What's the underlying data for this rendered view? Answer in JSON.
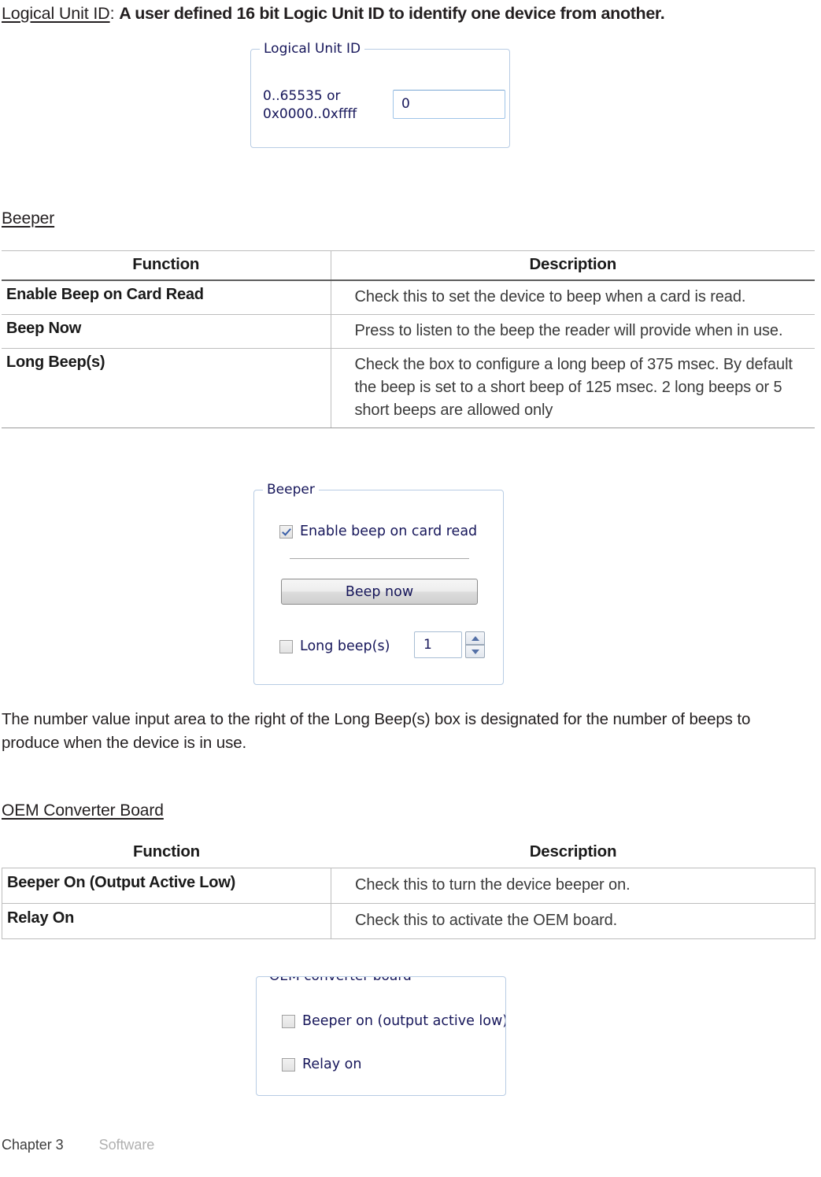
{
  "intro": {
    "term": "Logical Unit ID",
    "separator": ":",
    "description": "A user defined 16 bit Logic Unit ID to identify one device from another."
  },
  "logical_unit_id_panel": {
    "legend": "Logical Unit ID",
    "range_line1": "0..65535 or",
    "range_line2": "0x0000..0xffff",
    "input_value": "0"
  },
  "beeper_section": {
    "heading": "Beeper",
    "table": {
      "headers": [
        "Function",
        "Description"
      ],
      "rows": [
        {
          "function": "Enable Beep on Card Read",
          "description": "Check this to set the device to beep when a card is read."
        },
        {
          "function": "Beep Now",
          "description": "Press to listen to the beep the reader will provide when in use."
        },
        {
          "function": "Long Beep(s)",
          "description": "Check the box to configure a long beep of 375 msec. By default the beep is set to a short beep of 125 msec. 2 long beeps or 5 short beeps are allowed only"
        }
      ]
    }
  },
  "beeper_panel": {
    "legend": "Beeper",
    "enable_beep_label": "Enable beep on card read",
    "enable_beep_checked": true,
    "beep_now_button": "Beep now",
    "long_beep_label": "Long beep(s)",
    "long_beep_checked": false,
    "long_beep_count": "1"
  },
  "beeper_note": "The number value input area to the right of the Long Beep(s) box is designated for the number of beeps to produce when the device is in use.",
  "oem_section": {
    "heading": "OEM Converter Board",
    "table": {
      "headers": [
        "Function",
        "Description"
      ],
      "rows": [
        {
          "function": "Beeper On (Output Active Low)",
          "description": "Check this to turn the device beeper on."
        },
        {
          "function": "Relay On",
          "description": "Check this to activate the OEM board."
        }
      ]
    }
  },
  "oem_panel": {
    "legend": "OEM converter board",
    "beeper_on_label": "Beeper on (output active low)",
    "beeper_on_checked": false,
    "relay_on_label": "Relay on",
    "relay_on_checked": false
  },
  "footer": {
    "chapter": "Chapter 3",
    "section": "Software"
  },
  "colors": {
    "text": "#231f20",
    "table_border": "#bdbdbd",
    "header_rule": "#5d5d5d",
    "groupbox_border": "#b8cce4",
    "win_text": "#16165a",
    "check_mark": "#3a5fa8",
    "footer_muted": "#b0b0b0"
  }
}
